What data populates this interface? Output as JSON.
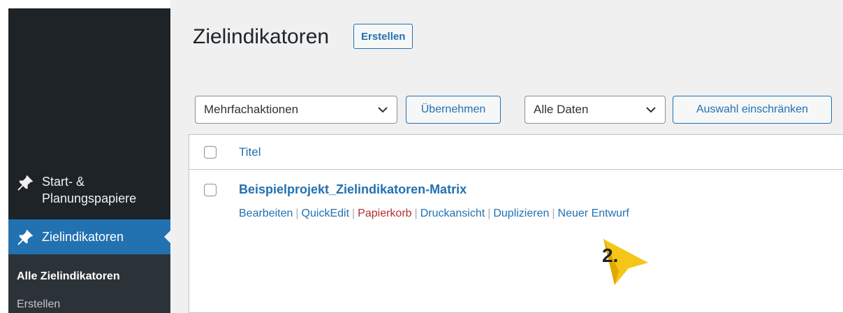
{
  "sidebar": {
    "items": [
      {
        "label": "Start- & Planungspapiere",
        "icon": "pin-icon"
      },
      {
        "label": "Zielindikatoren",
        "icon": "pin-icon",
        "active": true
      }
    ],
    "submenu": [
      "Alle Zielindikatoren",
      "Erstellen"
    ]
  },
  "header": {
    "title": "Zielindikatoren",
    "create_label": "Erstellen"
  },
  "toolbar": {
    "bulk_select": "Mehrfachaktionen",
    "apply_label": "Übernehmen",
    "dates_select": "Alle Daten",
    "filter_label": "Auswahl einschränken"
  },
  "table": {
    "column_title": "Titel",
    "rows": [
      {
        "title": "Beispielprojekt_Zielindikatoren-Matrix",
        "actions": [
          "Bearbeiten",
          "QuickEdit",
          "Papierkorb",
          "Druckansicht",
          "Duplizieren",
          "Neuer Entwurf"
        ]
      }
    ]
  },
  "annotation": {
    "label": "2.",
    "color": "#f5c518"
  }
}
